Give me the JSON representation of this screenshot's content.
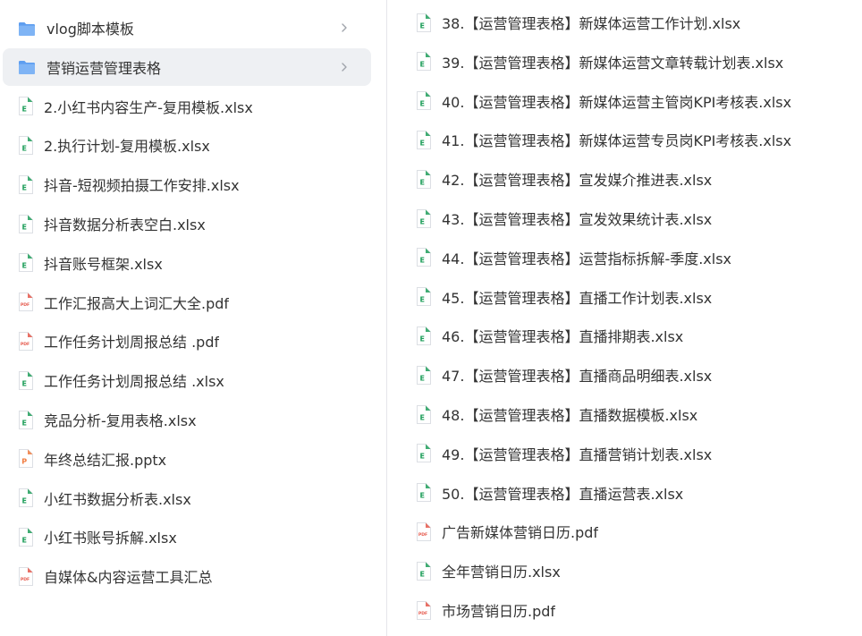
{
  "left_pane": {
    "items": [
      {
        "name": "vlog脚本模板",
        "kind": "folder",
        "selected": false
      },
      {
        "name": "营销运营管理表格",
        "kind": "folder",
        "selected": true
      },
      {
        "name": "2.小红书内容生产-复用模板.xlsx",
        "kind": "xlsx"
      },
      {
        "name": "2.执行计划-复用模板.xlsx",
        "kind": "xlsx"
      },
      {
        "name": "抖音-短视频拍摄工作安排.xlsx",
        "kind": "xlsx"
      },
      {
        "name": "抖音数据分析表空白.xlsx",
        "kind": "xlsx"
      },
      {
        "name": "抖音账号框架.xlsx",
        "kind": "xlsx"
      },
      {
        "name": "工作汇报高大上词汇大全.pdf",
        "kind": "pdf"
      },
      {
        "name": "工作任务计划周报总结 .pdf",
        "kind": "pdf"
      },
      {
        "name": "工作任务计划周报总结 .xlsx",
        "kind": "xlsx"
      },
      {
        "name": "竞品分析-复用表格.xlsx",
        "kind": "xlsx"
      },
      {
        "name": "年终总结汇报.pptx",
        "kind": "pptx"
      },
      {
        "name": "小红书数据分析表.xlsx",
        "kind": "xlsx"
      },
      {
        "name": "小红书账号拆解.xlsx",
        "kind": "xlsx"
      },
      {
        "name": "自媒体&内容运营工具汇总",
        "kind": "pdf"
      }
    ]
  },
  "right_pane": {
    "items": [
      {
        "name": "38.【运营管理表格】新媒体运营工作计划.xlsx",
        "kind": "xlsx"
      },
      {
        "name": "39.【运营管理表格】新媒体运营文章转载计划表.xlsx",
        "kind": "xlsx"
      },
      {
        "name": "40.【运营管理表格】新媒体运营主管岗KPI考核表.xlsx",
        "kind": "xlsx"
      },
      {
        "name": "41.【运营管理表格】新媒体运营专员岗KPI考核表.xlsx",
        "kind": "xlsx"
      },
      {
        "name": "42.【运营管理表格】宣发媒介推进表.xlsx",
        "kind": "xlsx"
      },
      {
        "name": "43.【运营管理表格】宣发效果统计表.xlsx",
        "kind": "xlsx"
      },
      {
        "name": "44.【运营管理表格】运营指标拆解-季度.xlsx",
        "kind": "xlsx"
      },
      {
        "name": "45.【运营管理表格】直播工作计划表.xlsx",
        "kind": "xlsx"
      },
      {
        "name": "46.【运营管理表格】直播排期表.xlsx",
        "kind": "xlsx"
      },
      {
        "name": "47.【运营管理表格】直播商品明细表.xlsx",
        "kind": "xlsx"
      },
      {
        "name": "48.【运营管理表格】直播数据模板.xlsx",
        "kind": "xlsx"
      },
      {
        "name": "49.【运营管理表格】直播营销计划表.xlsx",
        "kind": "xlsx"
      },
      {
        "name": "50.【运营管理表格】直播运营表.xlsx",
        "kind": "xlsx"
      },
      {
        "name": "广告新媒体营销日历.pdf",
        "kind": "pdf"
      },
      {
        "name": "全年营销日历.xlsx",
        "kind": "xlsx"
      },
      {
        "name": "市场营销日历.pdf",
        "kind": "pdf"
      }
    ]
  },
  "icon_labels": {
    "xlsx": "E",
    "pdf": "PDF",
    "pptx": "P"
  },
  "colors": {
    "folder": "#7fb4f5",
    "folder_tab": "#5e9ef0",
    "xlsx": "#1e9e5a",
    "pdf": "#e5574a",
    "pptx": "#f07b3f",
    "selected_bg": "#eef0f3",
    "text": "#333333",
    "chevron": "#a0a4ab"
  }
}
